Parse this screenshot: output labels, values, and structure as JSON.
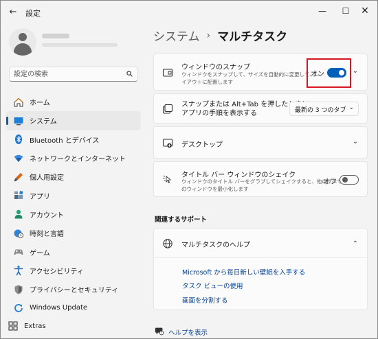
{
  "window": {
    "title": "設定",
    "back_glyph": "←",
    "minimize_glyph": "—",
    "maximize_glyph": "☐",
    "close_glyph": "✕"
  },
  "search": {
    "placeholder": "設定の検索",
    "icon": "search-icon"
  },
  "nav": {
    "items": [
      {
        "label": "ホーム",
        "icon": "home-icon",
        "active": false
      },
      {
        "label": "システム",
        "icon": "system-icon",
        "active": true
      },
      {
        "label": "Bluetooth とデバイス",
        "icon": "bluetooth-icon",
        "active": false
      },
      {
        "label": "ネットワークとインターネット",
        "icon": "network-icon",
        "active": false
      },
      {
        "label": "個人用設定",
        "icon": "personalization-icon",
        "active": false
      },
      {
        "label": "アプリ",
        "icon": "apps-icon",
        "active": false
      },
      {
        "label": "アカウント",
        "icon": "account-icon",
        "active": false
      },
      {
        "label": "時刻と言語",
        "icon": "time-language-icon",
        "active": false
      },
      {
        "label": "ゲーム",
        "icon": "gaming-icon",
        "active": false
      },
      {
        "label": "アクセシビリティ",
        "icon": "accessibility-icon",
        "active": false
      },
      {
        "label": "プライバシーとセキュリティ",
        "icon": "privacy-icon",
        "active": false
      },
      {
        "label": "Windows Update",
        "icon": "windows-update-icon",
        "active": false
      }
    ],
    "extras_label": "Extras"
  },
  "breadcrumb": {
    "parent": "システム",
    "separator": "›",
    "current": "マルチタスク"
  },
  "snap": {
    "title": "ウィンドウのスナップ",
    "desc_line1": "ウィンドウをスナップして、サイズを自動的に変更して、レ",
    "desc_line2": "イアウトに配置します",
    "state_label": "オン",
    "toggle_on": true,
    "chevron": "⌄"
  },
  "alt_tab": {
    "title_line1": "スナップまたは Alt+Tab を押したときに",
    "title_line2": "アプリの手順を表示する",
    "dropdown_value": "最新の 3 つのタブ",
    "dropdown_chevron": "⌄"
  },
  "desktop": {
    "title": "デスクトップ",
    "chevron": "⌄"
  },
  "shake": {
    "title": "タイトル バー ウィンドウのシェイク",
    "desc_line1": "ウィンドウのタイトル バーをグラブしてシェイクすると、他のすべて",
    "desc_line2": "のウィンドウを最小化します",
    "state_label": "オフ",
    "toggle_on": false
  },
  "support": {
    "section_title": "関連するサポート",
    "help_title": "マルチタスクのヘルプ",
    "chevron": "⌃",
    "links": [
      "Microsoft から毎日新しい壁紙を入手する",
      "タスク ビューの使用",
      "画面を分割する"
    ]
  },
  "footer": {
    "help_label": "ヘルプを表示"
  },
  "colors": {
    "accent": "#005fb8",
    "link": "#003e92",
    "highlight_box": "#d8141f"
  }
}
